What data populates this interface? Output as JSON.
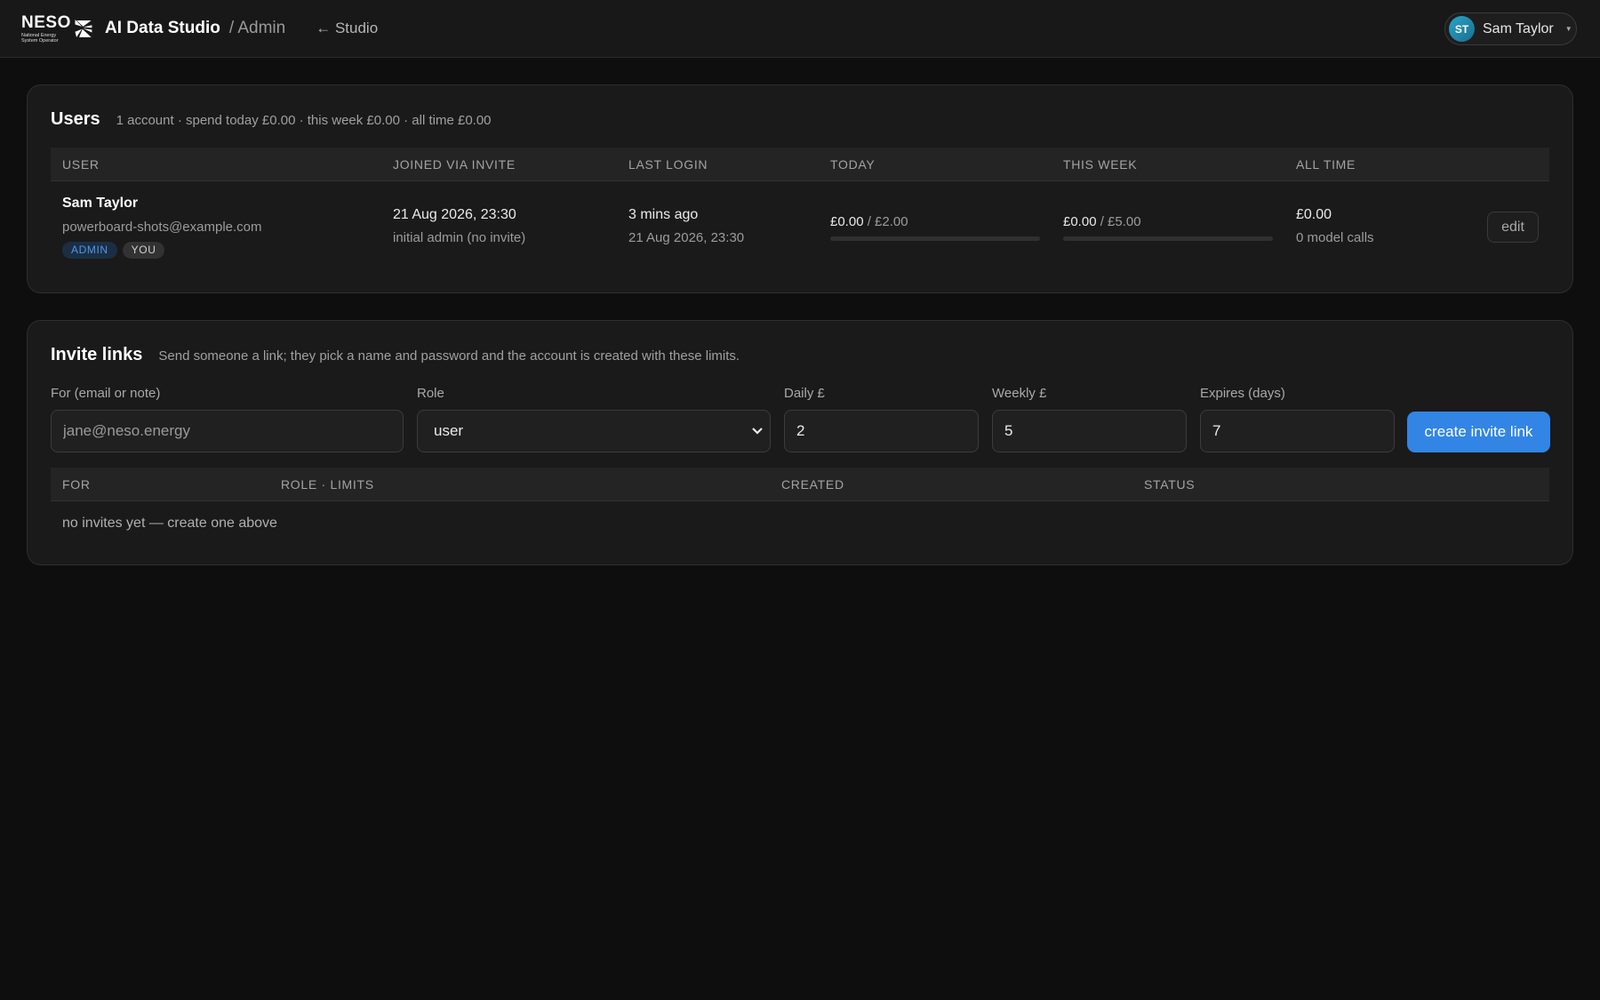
{
  "header": {
    "logo": {
      "wordmark": "NESO",
      "subtitle_line1": "National Energy",
      "subtitle_line2": "System Operator"
    },
    "app_title": "AI Data Studio",
    "breadcrumb": "/ Admin",
    "back_link": "← Studio",
    "user": {
      "initials": "ST",
      "name": "Sam Taylor"
    }
  },
  "users": {
    "title": "Users",
    "summary": "1 account · spend today £0.00 · this week £0.00 · all time £0.00",
    "columns": [
      "USER",
      "JOINED VIA INVITE",
      "LAST LOGIN",
      "TODAY",
      "THIS WEEK",
      "ALL TIME"
    ],
    "rows": [
      {
        "name": "Sam Taylor",
        "email": "powerboard-shots@example.com",
        "badges": [
          "ADMIN",
          "YOU"
        ],
        "joined": "21 Aug 2026, 23:30",
        "joined_note": "initial admin (no invite)",
        "last_login": "3 mins ago",
        "last_login_date": "21 Aug 2026, 23:30",
        "today_spent": "£0.00",
        "today_limit": "/ £2.00",
        "today_fraction": 0,
        "week_spent": "£0.00",
        "week_limit": "/ £5.00",
        "week_fraction": 0,
        "all_time": "£0.00",
        "model_calls": "0 model calls",
        "edit_label": "edit"
      }
    ]
  },
  "invites": {
    "title": "Invite links",
    "description": "Send someone a link; they pick a name and password and the account is created with these limits.",
    "form": {
      "for_label": "For (email or note)",
      "for_placeholder": "jane@neso.energy",
      "role_label": "Role",
      "role_value": "user",
      "daily_label": "Daily £",
      "daily_value": "2",
      "weekly_label": "Weekly £",
      "weekly_value": "5",
      "expires_label": "Expires (days)",
      "expires_value": "7",
      "submit_label": "create invite link"
    },
    "columns": [
      "FOR",
      "ROLE · LIMITS",
      "CREATED",
      "STATUS"
    ],
    "empty_message": "no invites yet — create one above"
  },
  "colors": {
    "accent": "#3285e4",
    "background": "#0e0e0e",
    "card": "#1a1a1a"
  }
}
